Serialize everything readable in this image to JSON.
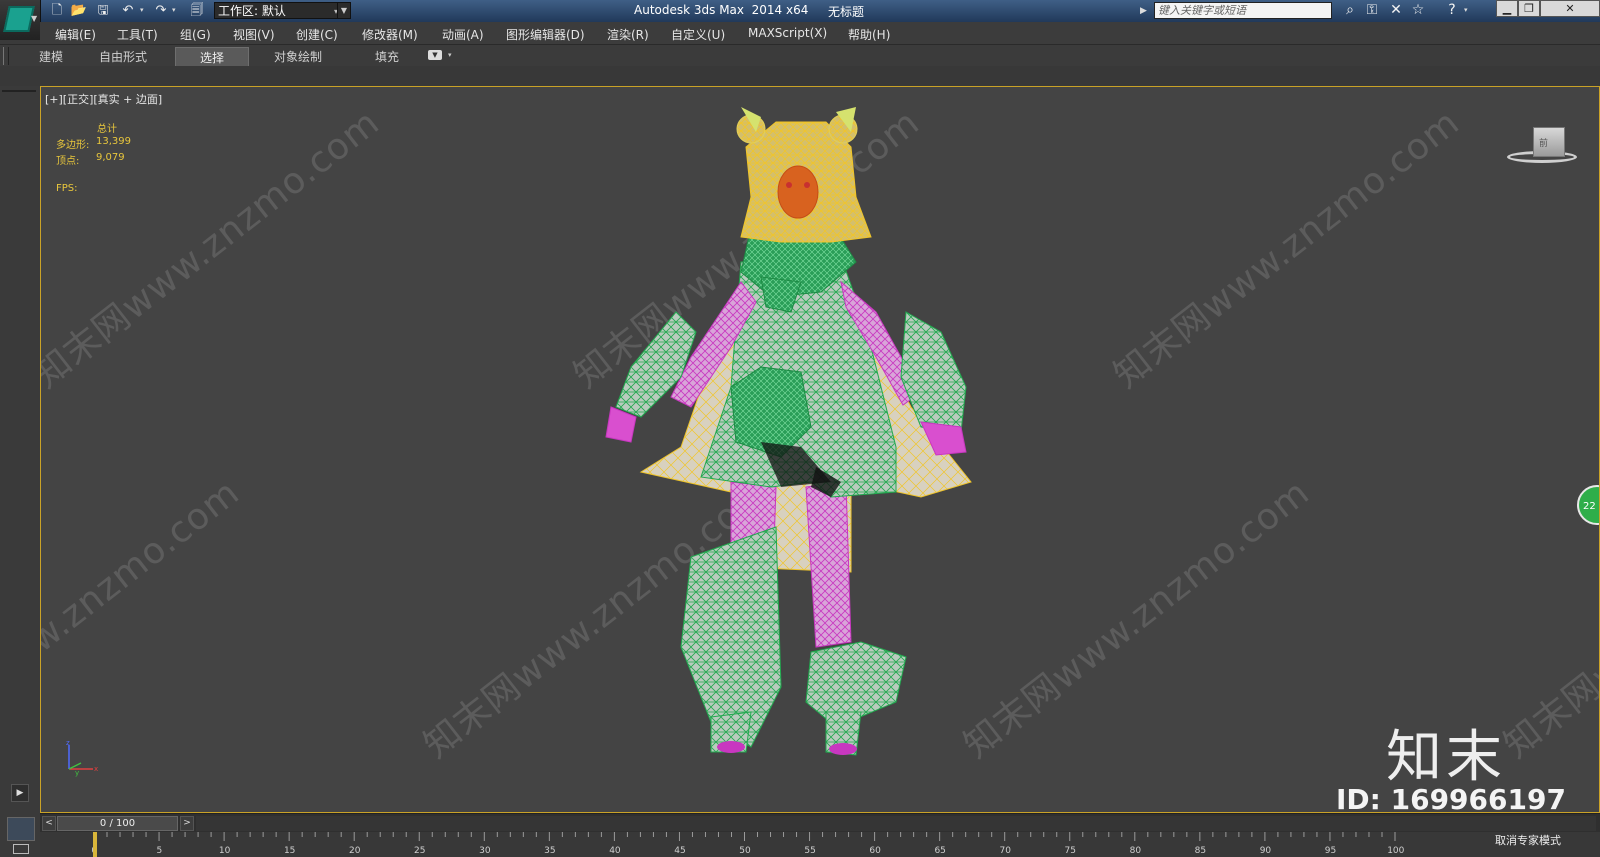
{
  "titlebar": {
    "app_title": "Autodesk 3ds Max  2014 x64",
    "doc_title": "无标题",
    "workspace_label": "工作区: 默认",
    "search_placeholder": "键入关键字或短语",
    "quick_access_icons": [
      "new-file-icon",
      "open-folder-icon",
      "save-icon",
      "undo-icon",
      "redo-icon",
      "project-folder-icon"
    ],
    "toolbar_icons": [
      "binoculars-icon",
      "key-icon",
      "exchange-icon",
      "star-icon",
      "help-icon"
    ],
    "window_buttons": [
      "minimize",
      "restore",
      "close"
    ]
  },
  "menubar": {
    "items": [
      "编辑(E)",
      "工具(T)",
      "组(G)",
      "视图(V)",
      "创建(C)",
      "修改器(M)",
      "动画(A)",
      "图形编辑器(D)",
      "渲染(R)",
      "自定义(U)",
      "MAXScript(X)",
      "帮助(H)"
    ]
  },
  "ribbon": {
    "tabs": [
      "建模",
      "自由形式",
      "选择",
      "对象绘制",
      "填充"
    ],
    "active_tab": "选择"
  },
  "viewport": {
    "label": "[+][正交][真实 + 边面]",
    "stats": {
      "header": "总计",
      "polygons_label": "多边形:",
      "polygons_value": "13,399",
      "vertices_label": "顶点:",
      "vertices_value": "9,079",
      "fps_label": "FPS:"
    },
    "viewcube_label": "前",
    "badge_text": "22",
    "watermark_text": "知末网www.znzmo.com",
    "brand_logo": "知末",
    "brand_id": "ID: 169966197",
    "colors": {
      "border": "#c9a227",
      "background": "#444444",
      "stats_text": "#e8c63c",
      "wire_green": "#25b85a",
      "wire_yellow": "#f0c52a",
      "skin_pink": "#d94fcf"
    },
    "model": "anime-girl-character-wireframe"
  },
  "timeslider": {
    "position_label": "0 / 100",
    "prev": "<",
    "next": ">"
  },
  "trackbar": {
    "ticks": [
      "0",
      "5",
      "10",
      "15",
      "20",
      "25",
      "30",
      "35",
      "40",
      "45",
      "50",
      "55",
      "60",
      "65",
      "70",
      "75",
      "80",
      "85",
      "90",
      "95",
      "100"
    ],
    "status_text": "取消专家模式"
  }
}
